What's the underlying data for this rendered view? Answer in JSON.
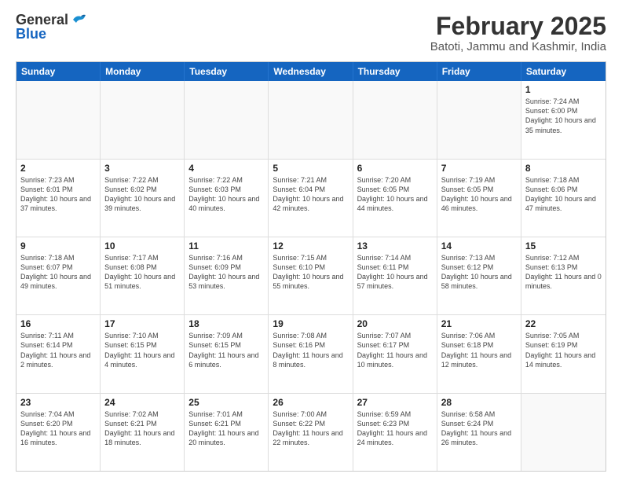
{
  "logo": {
    "general": "General",
    "blue": "Blue"
  },
  "title": "February 2025",
  "location": "Batoti, Jammu and Kashmir, India",
  "weekdays": [
    "Sunday",
    "Monday",
    "Tuesday",
    "Wednesday",
    "Thursday",
    "Friday",
    "Saturday"
  ],
  "rows": [
    [
      {
        "day": "",
        "text": ""
      },
      {
        "day": "",
        "text": ""
      },
      {
        "day": "",
        "text": ""
      },
      {
        "day": "",
        "text": ""
      },
      {
        "day": "",
        "text": ""
      },
      {
        "day": "",
        "text": ""
      },
      {
        "day": "1",
        "text": "Sunrise: 7:24 AM\nSunset: 6:00 PM\nDaylight: 10 hours and 35 minutes."
      }
    ],
    [
      {
        "day": "2",
        "text": "Sunrise: 7:23 AM\nSunset: 6:01 PM\nDaylight: 10 hours and 37 minutes."
      },
      {
        "day": "3",
        "text": "Sunrise: 7:22 AM\nSunset: 6:02 PM\nDaylight: 10 hours and 39 minutes."
      },
      {
        "day": "4",
        "text": "Sunrise: 7:22 AM\nSunset: 6:03 PM\nDaylight: 10 hours and 40 minutes."
      },
      {
        "day": "5",
        "text": "Sunrise: 7:21 AM\nSunset: 6:04 PM\nDaylight: 10 hours and 42 minutes."
      },
      {
        "day": "6",
        "text": "Sunrise: 7:20 AM\nSunset: 6:05 PM\nDaylight: 10 hours and 44 minutes."
      },
      {
        "day": "7",
        "text": "Sunrise: 7:19 AM\nSunset: 6:05 PM\nDaylight: 10 hours and 46 minutes."
      },
      {
        "day": "8",
        "text": "Sunrise: 7:18 AM\nSunset: 6:06 PM\nDaylight: 10 hours and 47 minutes."
      }
    ],
    [
      {
        "day": "9",
        "text": "Sunrise: 7:18 AM\nSunset: 6:07 PM\nDaylight: 10 hours and 49 minutes."
      },
      {
        "day": "10",
        "text": "Sunrise: 7:17 AM\nSunset: 6:08 PM\nDaylight: 10 hours and 51 minutes."
      },
      {
        "day": "11",
        "text": "Sunrise: 7:16 AM\nSunset: 6:09 PM\nDaylight: 10 hours and 53 minutes."
      },
      {
        "day": "12",
        "text": "Sunrise: 7:15 AM\nSunset: 6:10 PM\nDaylight: 10 hours and 55 minutes."
      },
      {
        "day": "13",
        "text": "Sunrise: 7:14 AM\nSunset: 6:11 PM\nDaylight: 10 hours and 57 minutes."
      },
      {
        "day": "14",
        "text": "Sunrise: 7:13 AM\nSunset: 6:12 PM\nDaylight: 10 hours and 58 minutes."
      },
      {
        "day": "15",
        "text": "Sunrise: 7:12 AM\nSunset: 6:13 PM\nDaylight: 11 hours and 0 minutes."
      }
    ],
    [
      {
        "day": "16",
        "text": "Sunrise: 7:11 AM\nSunset: 6:14 PM\nDaylight: 11 hours and 2 minutes."
      },
      {
        "day": "17",
        "text": "Sunrise: 7:10 AM\nSunset: 6:15 PM\nDaylight: 11 hours and 4 minutes."
      },
      {
        "day": "18",
        "text": "Sunrise: 7:09 AM\nSunset: 6:15 PM\nDaylight: 11 hours and 6 minutes."
      },
      {
        "day": "19",
        "text": "Sunrise: 7:08 AM\nSunset: 6:16 PM\nDaylight: 11 hours and 8 minutes."
      },
      {
        "day": "20",
        "text": "Sunrise: 7:07 AM\nSunset: 6:17 PM\nDaylight: 11 hours and 10 minutes."
      },
      {
        "day": "21",
        "text": "Sunrise: 7:06 AM\nSunset: 6:18 PM\nDaylight: 11 hours and 12 minutes."
      },
      {
        "day": "22",
        "text": "Sunrise: 7:05 AM\nSunset: 6:19 PM\nDaylight: 11 hours and 14 minutes."
      }
    ],
    [
      {
        "day": "23",
        "text": "Sunrise: 7:04 AM\nSunset: 6:20 PM\nDaylight: 11 hours and 16 minutes."
      },
      {
        "day": "24",
        "text": "Sunrise: 7:02 AM\nSunset: 6:21 PM\nDaylight: 11 hours and 18 minutes."
      },
      {
        "day": "25",
        "text": "Sunrise: 7:01 AM\nSunset: 6:21 PM\nDaylight: 11 hours and 20 minutes."
      },
      {
        "day": "26",
        "text": "Sunrise: 7:00 AM\nSunset: 6:22 PM\nDaylight: 11 hours and 22 minutes."
      },
      {
        "day": "27",
        "text": "Sunrise: 6:59 AM\nSunset: 6:23 PM\nDaylight: 11 hours and 24 minutes."
      },
      {
        "day": "28",
        "text": "Sunrise: 6:58 AM\nSunset: 6:24 PM\nDaylight: 11 hours and 26 minutes."
      },
      {
        "day": "",
        "text": ""
      }
    ]
  ]
}
